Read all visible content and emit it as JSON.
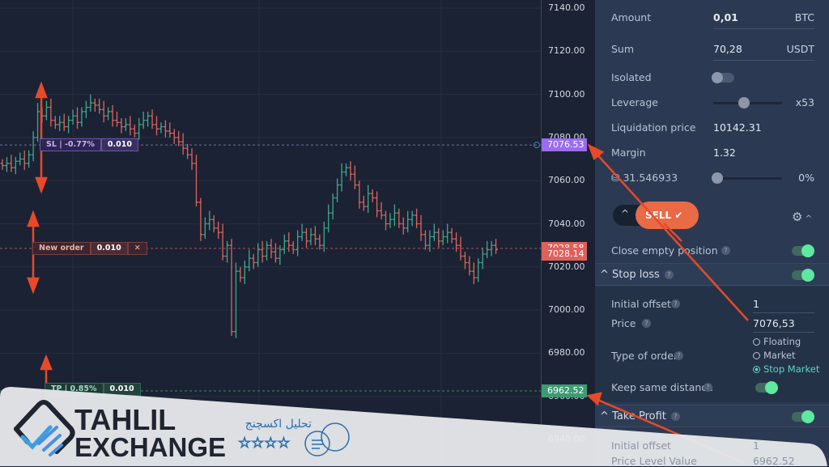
{
  "chart": {
    "price_ticks": [
      7140,
      7120,
      7100,
      7080,
      7060,
      7040,
      7020,
      7000,
      6980,
      6960,
      6940
    ],
    "closes": [
      7067,
      7068,
      7066,
      7069,
      7070,
      7068,
      7072,
      7080,
      7092,
      7090,
      7094,
      7088,
      7086,
      7087,
      7085,
      7088,
      7090,
      7087,
      7092,
      7094,
      7096,
      7095,
      7093,
      7090,
      7092,
      7088,
      7087,
      7085,
      7086,
      7084,
      7082,
      7086,
      7088,
      7090,
      7086,
      7084,
      7085,
      7083,
      7082,
      7080,
      7078,
      7075,
      7072,
      7068,
      7050,
      7035,
      7040,
      7042,
      7038,
      7036,
      7025,
      7030,
      6990,
      7018,
      7015,
      7020,
      7024,
      7022,
      7028,
      7025,
      7030,
      7027,
      7024,
      7028,
      7032,
      7030,
      7028,
      7034,
      7036,
      7032,
      7035,
      7033,
      7030,
      7038,
      7045,
      7052,
      7058,
      7064,
      7066,
      7063,
      7058,
      7050,
      7048,
      7054,
      7052,
      7046,
      7044,
      7040,
      7042,
      7045,
      7040,
      7038,
      7042,
      7044,
      7040,
      7035,
      7030,
      7034,
      7036,
      7032,
      7034,
      7036,
      7033,
      7030,
      7025,
      7022,
      7018,
      7015,
      7022,
      7026,
      7028,
      7030,
      7028
    ],
    "bar_colors": {
      "up": "#3fa88f",
      "down": "#d9665f"
    },
    "sl_price_label": "7076.53",
    "sl_price": 7076.53,
    "ask_label": "7028.58",
    "bid_label": "7028.14",
    "ask": 7028.58,
    "bid": 7028.14,
    "tp_price_label": "6962.52",
    "tp_price": 6962.52,
    "sl_tag": {
      "text": "SL | -0.77%",
      "qty": "0.010"
    },
    "order_tag": {
      "text": "New order",
      "qty": "0.010"
    },
    "tp_tag": {
      "text": "TP | 0.85%",
      "qty": "0.010"
    }
  },
  "panel": {
    "amount": {
      "label": "Amount",
      "value": "0,01",
      "unit": "BTC"
    },
    "sum": {
      "label": "Sum",
      "value": "70,28",
      "unit": "USDT"
    },
    "isolated": {
      "label": "Isolated",
      "on": false
    },
    "leverage": {
      "label": "Leverage",
      "value": "x53",
      "level": 0.45
    },
    "liq": {
      "label": "Liquidation price",
      "value": "10142.31"
    },
    "margin": {
      "label": "Margin",
      "value": "1.32"
    },
    "balance": {
      "value": "31.546933",
      "percent": "0%",
      "level": 0
    },
    "sell_label": "SELL",
    "close_empty": {
      "label": "Close empty position",
      "on": true
    },
    "stop_loss": {
      "label": "Stop loss",
      "on": true,
      "initial_offset_label": "Initial offset",
      "initial_offset": "1",
      "price_label": "Price",
      "price": "7076,53",
      "type_label": "Type of order",
      "types": [
        "Floating",
        "Market",
        "Stop Market"
      ],
      "selected": "Stop Market",
      "keep_label": "Keep same distance",
      "keep_on": true
    },
    "take_profit": {
      "label": "Take Profit",
      "on": true,
      "initial_offset_label": "Initial offset",
      "initial_offset": "1",
      "price_label": "Price Level Value",
      "price": "6962.52"
    }
  },
  "watermark": {
    "line1": "TAHLIL",
    "line2": "EXCHANGE",
    "persian": "تحلیل اکسچنج"
  },
  "colors": {
    "annotation_arrow": "#e8492a",
    "sl": "#9b6cf0",
    "tp": "#3d9b74",
    "order": "#d9665f"
  }
}
